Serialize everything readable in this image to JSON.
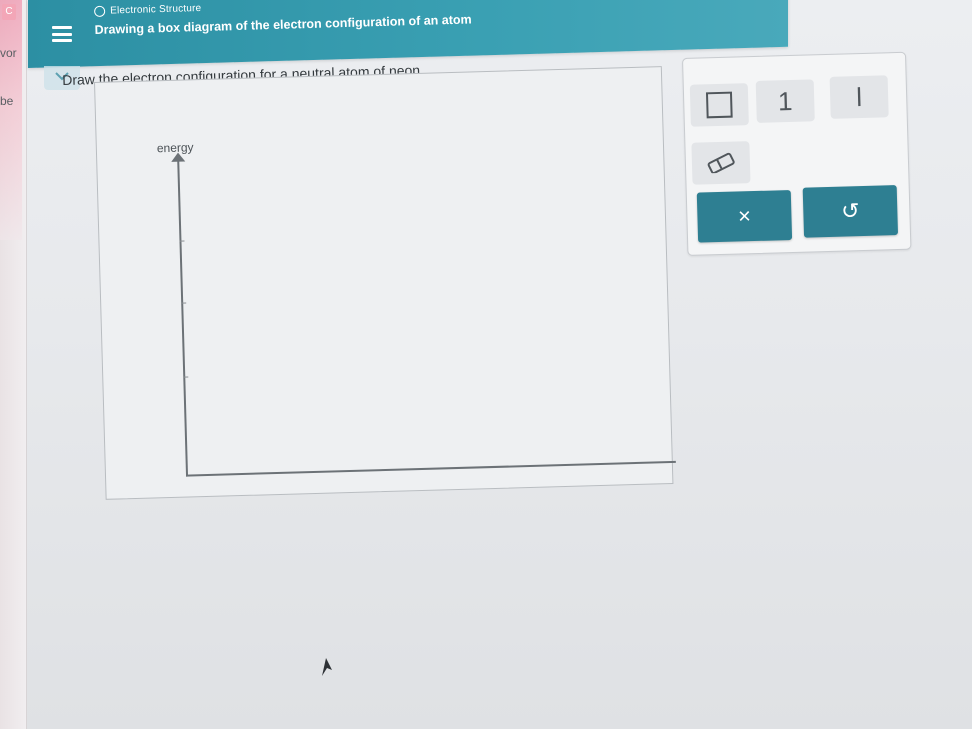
{
  "sidebar": {
    "fragment_1": "vor",
    "fragment_2": "be"
  },
  "header": {
    "topic": "Electronic Structure",
    "title": "Drawing a box diagram of the electron configuration of an atom"
  },
  "question": {
    "instruction": "Draw the electron configuration for a neutral atom of neon."
  },
  "diagram": {
    "axis_label": "energy"
  },
  "palette": {
    "tools": [
      {
        "name": "orbital-box",
        "icon": "square-icon"
      },
      {
        "name": "spin-up-electron",
        "glyph": "1",
        "icon": "arrow-up-icon"
      },
      {
        "name": "spin-down-electron",
        "glyph": "l",
        "icon": "arrow-down-icon"
      },
      {
        "name": "eraser",
        "icon": "eraser-icon"
      }
    ],
    "clear_glyph": "×",
    "undo_glyph": "↺"
  },
  "colors": {
    "header": "#3aa0b3",
    "action_button": "#2e7f92"
  }
}
